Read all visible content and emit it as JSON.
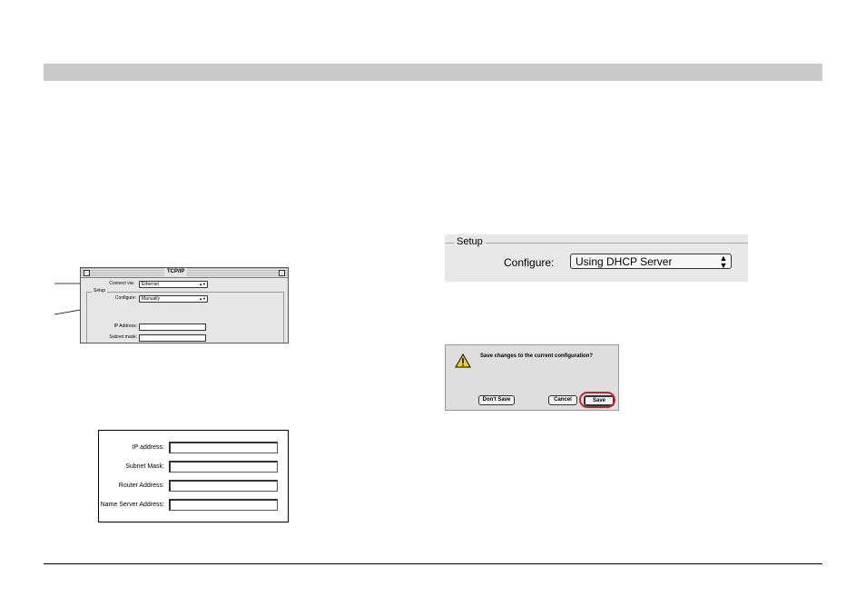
{
  "tcpip_window": {
    "title": "TCP/IP",
    "connect_via_label": "Connect via:",
    "connect_via_value": "Ethernet",
    "setup_label": "Setup",
    "configure_label": "Configure:",
    "configure_value": "Manually",
    "ip_address_label": "IP Address:",
    "subnet_mask_label": "Subnet mask:"
  },
  "address_form": {
    "ip_address_label": "IP address:",
    "subnet_mask_label": "Subnet Mask:",
    "router_address_label": "Router Address:",
    "name_server_label": "Name Server Address:"
  },
  "setup_panel": {
    "title": "Setup",
    "configure_label": "Configure:",
    "configure_value": "Using DHCP Server"
  },
  "save_dialog": {
    "message": "Save changes to the current configuration?",
    "dont_save_label": "Don't Save",
    "cancel_label": "Cancel",
    "save_label": "Save",
    "warning_icon": "warning-icon",
    "highlight_color": "#c0272d"
  },
  "colors": {
    "header_bar": "#c9c9c9"
  }
}
